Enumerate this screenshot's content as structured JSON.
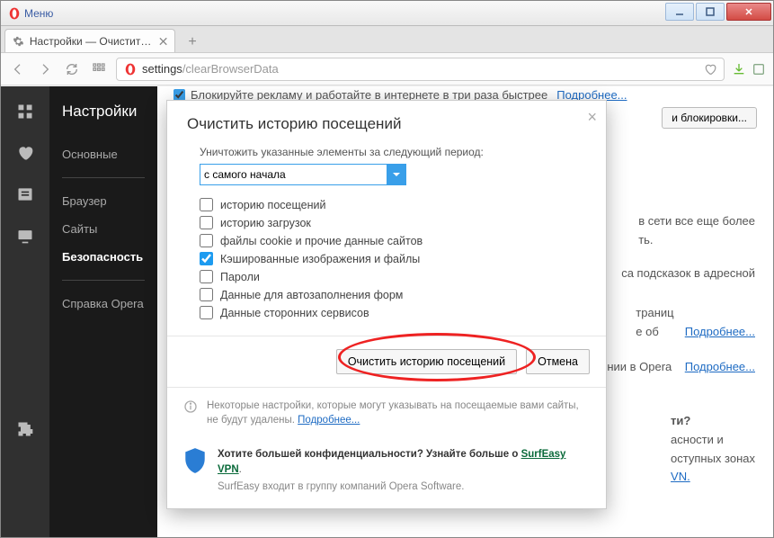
{
  "window": {
    "menu_label": "Меню",
    "tab_title": "Настройки — Очистить и...",
    "address_prefix": "settings",
    "address_path": "/clearBrowserData"
  },
  "sidebar": {
    "title": "Настройки",
    "items": [
      "Основные",
      "Браузер",
      "Сайты",
      "Безопасность"
    ],
    "active_index": 3,
    "help_label": "Справка Opera"
  },
  "background": {
    "adblock_text": "Блокируйте рекламу и работайте в интернете в три раза быстрее",
    "adblock_more": "Подробнее...",
    "adblock_btn": "и блокировки...",
    "frag1": "в сети все еще более",
    "frag1b": "ть.",
    "frag2": "са подсказок в адресной",
    "frag3a": "траниц",
    "frag3b": "е об",
    "frag3_more": "Подробнее...",
    "frag4a": "нии в Opera",
    "frag4_more": "Подробнее...",
    "frag5_title": "ти?",
    "frag5a": "асности и",
    "frag5b": "оступных зонах",
    "frag5_link": "VN."
  },
  "dialog": {
    "title": "Очистить историю посещений",
    "prompt": "Уничтожить указанные элементы за следующий период:",
    "period_selected": "с самого начала",
    "checks": [
      {
        "label": "историю посещений",
        "checked": false
      },
      {
        "label": "историю загрузок",
        "checked": false
      },
      {
        "label": "файлы cookie и прочие данные сайтов",
        "checked": false
      },
      {
        "label": "Кэшированные изображения и файлы",
        "checked": true
      },
      {
        "label": "Пароли",
        "checked": false
      },
      {
        "label": "Данные для автозаполнения форм",
        "checked": false
      },
      {
        "label": "Данные сторонних сервисов",
        "checked": false
      }
    ],
    "clear_btn": "Очистить историю посещений",
    "cancel_btn": "Отмена",
    "note_text": "Некоторые настройки, которые могут указывать на посещаемые вами сайты, не будут удалены. ",
    "note_more": "Подробнее...",
    "vpn_strong": "Хотите большей конфиденциальности? Узнайте больше о ",
    "vpn_brand": "SurfEasy VPN",
    "vpn_sub": "SurfEasy входит в группу компаний Opera Software."
  }
}
